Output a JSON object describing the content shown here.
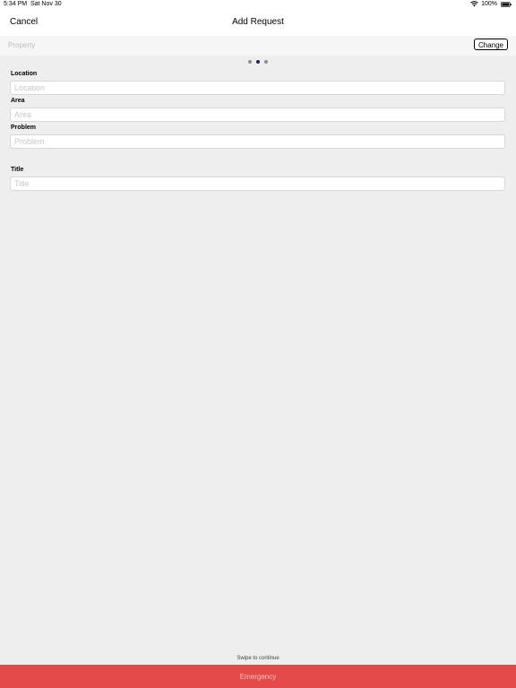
{
  "status_bar": {
    "time": "5:34 PM",
    "date": "Sat Nov 30",
    "battery": "100%",
    "wifi_icon": "wifi-icon",
    "battery_icon": "battery-icon"
  },
  "nav": {
    "cancel_label": "Cancel",
    "title": "Add Request"
  },
  "property": {
    "label": "Property",
    "change_label": "Change"
  },
  "pager": {
    "count": 3,
    "active_index": 1
  },
  "fields": {
    "location": {
      "label": "Location",
      "placeholder": "Location",
      "value": ""
    },
    "area": {
      "label": "Area",
      "placeholder": "Area",
      "value": ""
    },
    "problem": {
      "label": "Problem",
      "placeholder": "Problem",
      "value": ""
    },
    "title": {
      "label": "Title",
      "placeholder": "Title",
      "value": ""
    }
  },
  "footer": {
    "swipe_hint": "Swipe to continue",
    "emergency_label": "Emergency"
  },
  "colors": {
    "emergency": "#e34a4a",
    "dot_active": "#1c2a5a",
    "dot_inactive": "#8d8d8d"
  }
}
